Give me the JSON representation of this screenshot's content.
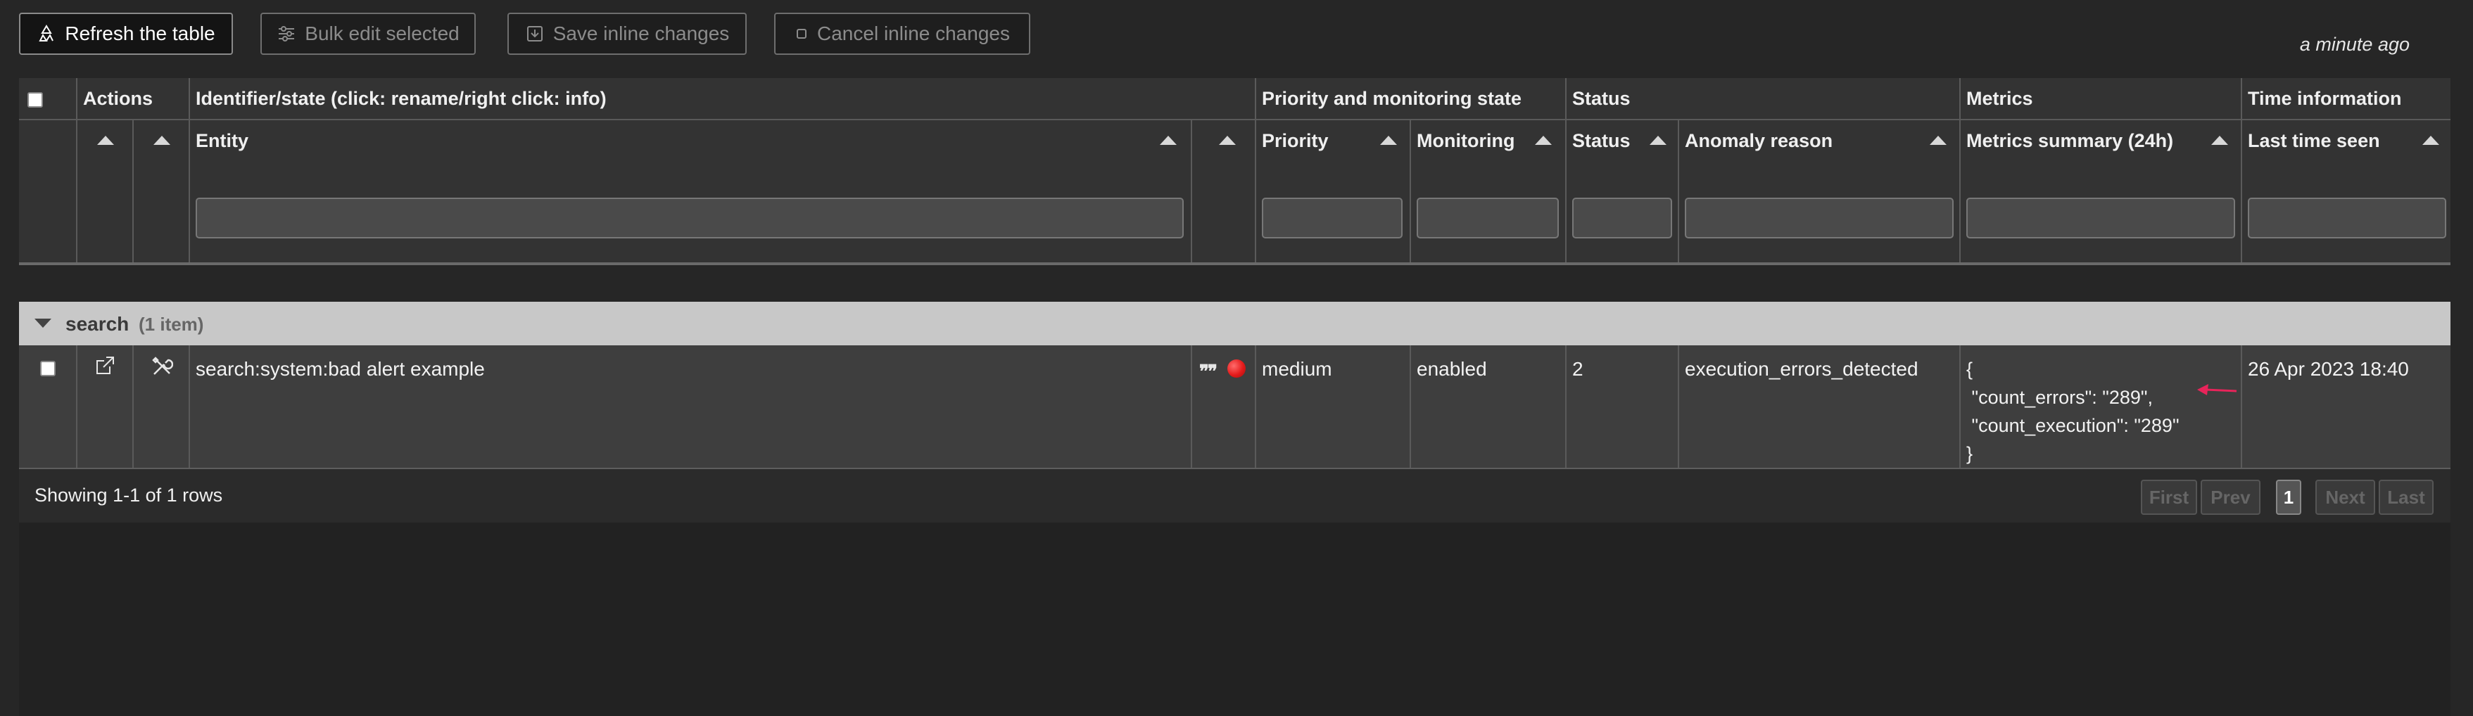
{
  "toolbar": {
    "refresh_label": "Refresh the table",
    "bulk_edit_label": "Bulk edit selected",
    "save_label": "Save inline changes",
    "cancel_label": "Cancel inline changes",
    "last_updated": "a minute ago"
  },
  "table": {
    "groups": {
      "actions": "Actions",
      "identifier": "Identifier/state (click: rename/right click: info)",
      "priority_monitoring": "Priority and monitoring state",
      "status": "Status",
      "metrics": "Metrics",
      "time": "Time information"
    },
    "columns": {
      "entity": "Entity",
      "priority": "Priority",
      "monitoring": "Monitoring",
      "status": "Status",
      "anomaly_reason": "Anomaly reason",
      "metrics_summary": "Metrics summary (24h)",
      "last_seen": "Last time seen"
    },
    "group_row": {
      "name": "search",
      "count": "(1 item)"
    },
    "rows": [
      {
        "entity": "search:system:bad alert example",
        "state_color": "#e41b1b",
        "priority": "medium",
        "monitoring": "enabled",
        "status": "2",
        "anomaly_reason": "execution_errors_detected",
        "metrics_summary": "{\n \"count_errors\": \"289\",\n \"count_execution\": \"289\"\n}",
        "last_seen": "26 Apr 2023 18:40"
      }
    ],
    "footer": {
      "showing": "Showing 1-1 of 1 rows",
      "first": "First",
      "prev": "Prev",
      "page": "1",
      "next": "Next",
      "last": "Last"
    }
  },
  "colors": {
    "arrow": "#e8245a",
    "status_dot": "#e41b1b"
  }
}
